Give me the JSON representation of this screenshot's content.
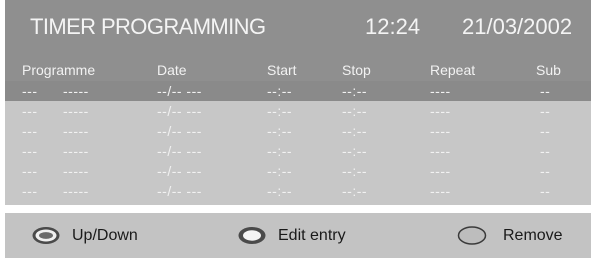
{
  "header": {
    "title": "TIMER PROGRAMMING",
    "time": "12:24",
    "date": "21/03/2002"
  },
  "columns": {
    "programme": "Programme",
    "date": "Date",
    "start": "Start",
    "stop": "Stop",
    "repeat": "Repeat",
    "sub": "Sub"
  },
  "rows": [
    {
      "prog_num": "---",
      "prog_name": "-----",
      "date": "--/-- ---",
      "start": "--:--",
      "stop": "--:--",
      "repeat": "----",
      "sub": "--"
    },
    {
      "prog_num": "---",
      "prog_name": "-----",
      "date": "--/-- ---",
      "start": "--:--",
      "stop": "--:--",
      "repeat": "----",
      "sub": "--"
    },
    {
      "prog_num": "---",
      "prog_name": "-----",
      "date": "--/-- ---",
      "start": "--:--",
      "stop": "--:--",
      "repeat": "----",
      "sub": "--"
    },
    {
      "prog_num": "---",
      "prog_name": "-----",
      "date": "--/-- ---",
      "start": "--:--",
      "stop": "--:--",
      "repeat": "----",
      "sub": "--"
    },
    {
      "prog_num": "---",
      "prog_name": "-----",
      "date": "--/-- ---",
      "start": "--:--",
      "stop": "--:--",
      "repeat": "----",
      "sub": "--"
    },
    {
      "prog_num": "---",
      "prog_name": "-----",
      "date": "--/-- ---",
      "start": "--:--",
      "stop": "--:--",
      "repeat": "----",
      "sub": "--"
    }
  ],
  "footer": {
    "up_down": "Up/Down",
    "edit_entry": "Edit entry",
    "remove": "Remove"
  },
  "colors": {
    "header_bg": "#8f8f8f",
    "grid_bg": "#c7c7c7",
    "selected_row": "#8a8a8a",
    "footer_bg": "#c3c3c3",
    "text": "#f2f2f2"
  },
  "icons": {
    "up_down": "oval-nav-ring-icon",
    "edit_entry": "oval-ok-button-icon",
    "remove": "oval-plain-button-icon"
  }
}
